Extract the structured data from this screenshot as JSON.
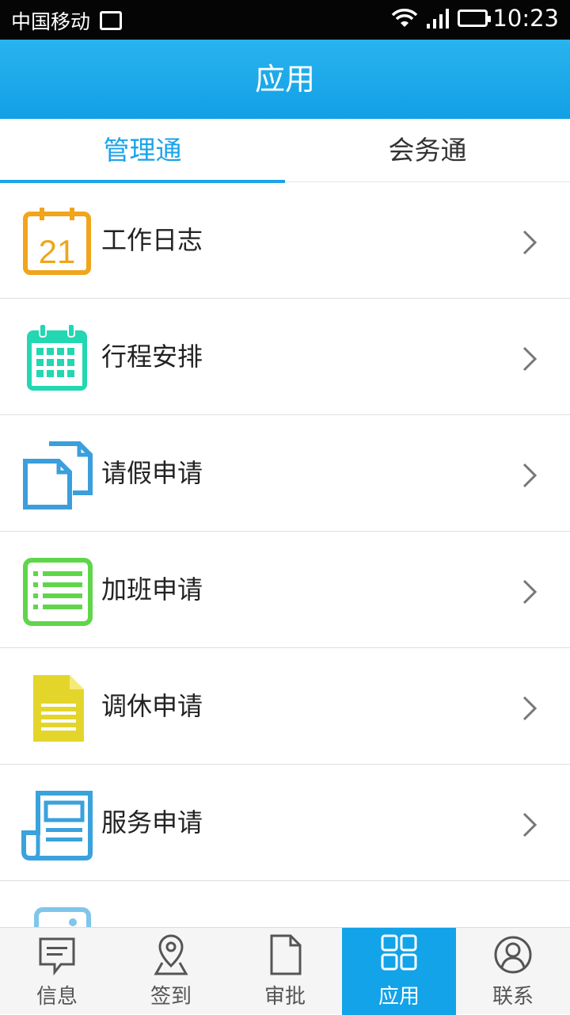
{
  "status_bar": {
    "carrier": "中国移动",
    "time": "10:23"
  },
  "header": {
    "title": "应用"
  },
  "tabs": [
    {
      "label": "管理通",
      "active": true
    },
    {
      "label": "会务通",
      "active": false
    }
  ],
  "list": [
    {
      "label": "工作日志",
      "icon": "calendar-21-icon",
      "color": "#f0a51c",
      "icon_text": "21"
    },
    {
      "label": "行程安排",
      "icon": "calendar-grid-icon",
      "color": "#22d7b1"
    },
    {
      "label": "请假申请",
      "icon": "copy-documents-icon",
      "color": "#3a9fdc"
    },
    {
      "label": "加班申请",
      "icon": "list-icon",
      "color": "#5fd64a"
    },
    {
      "label": "调休申请",
      "icon": "document-icon",
      "color": "#e4d52b"
    },
    {
      "label": "服务申请",
      "icon": "newspaper-icon",
      "color": "#3aa2dc"
    }
  ],
  "bottom_nav": [
    {
      "label": "信息",
      "icon": "message-icon"
    },
    {
      "label": "签到",
      "icon": "location-pin-icon"
    },
    {
      "label": "审批",
      "icon": "file-icon"
    },
    {
      "label": "应用",
      "icon": "grid-apps-icon",
      "active": true
    },
    {
      "label": "联系",
      "icon": "contact-person-icon"
    }
  ],
  "colors": {
    "accent": "#1ba3e8",
    "status_bar": "#050505"
  }
}
